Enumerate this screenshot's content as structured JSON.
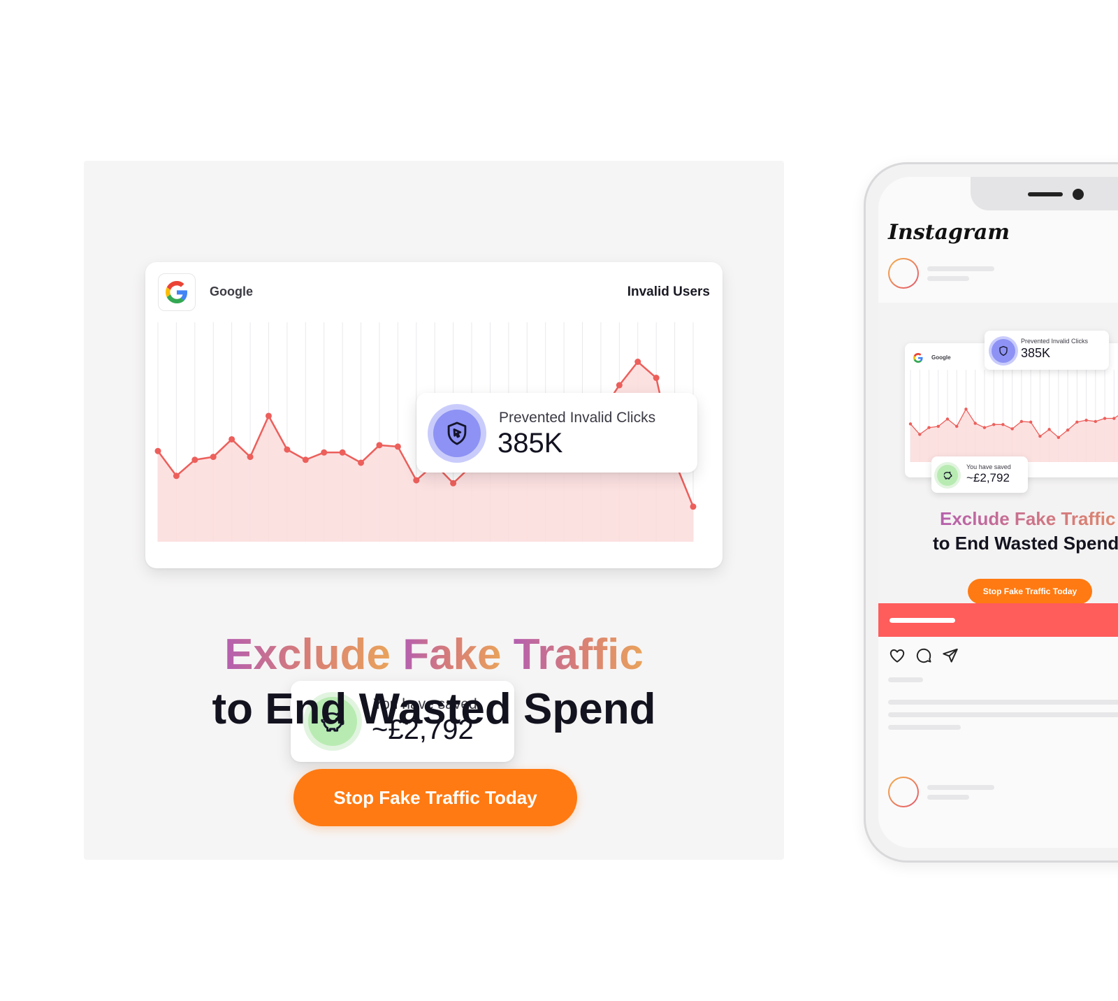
{
  "ad": {
    "google_label": "Google",
    "invalid_users_label": "Invalid Users",
    "stat_title": "Prevented Invalid Clicks",
    "stat_value": "385K",
    "saved_title": "You have saved",
    "saved_value": "~£2,792",
    "headline_line1_a": "Exclude",
    "headline_line1_b": "Fake",
    "headline_line1_c": "Traffic",
    "headline_line2": "to End Wasted Spend",
    "cta_label": "Stop Fake Traffic Today",
    "icons": [
      "google-g-icon",
      "shield-cursor-icon",
      "piggy-bank-icon"
    ],
    "colors": {
      "cta": "#ff7a12",
      "line": "#ec5f5b",
      "area": "#fbdcdc",
      "shield_badge": "#8d92f4",
      "pig_badge": "#b8ebb2",
      "gradient": [
        "#b45fb0",
        "#d87e76",
        "#e9a35b"
      ]
    }
  },
  "phone": {
    "app_name": "Instagram",
    "post": {
      "google_label": "Google",
      "stat_title": "Prevented Invalid Clicks",
      "stat_value": "385K",
      "saved_title": "You have saved",
      "saved_value": "~£2,792",
      "headline_line1": "Exclude Fake Traffic",
      "headline_line2": "to End Wasted Spend",
      "cta_label": "Stop Fake Traffic Today"
    },
    "banner_color": "#ff5c5c",
    "action_icons": [
      "heart-icon",
      "comment-icon",
      "send-icon"
    ]
  },
  "chart_data": {
    "type": "area",
    "title": "",
    "xlabel": "",
    "ylabel": "",
    "grid": "vertical",
    "y": [
      62,
      45,
      56,
      58,
      70,
      58,
      86,
      63,
      56,
      61,
      61,
      54,
      66,
      65,
      42,
      53,
      40,
      52,
      65,
      68,
      66,
      71,
      71,
      81,
      88,
      107,
      123,
      112,
      55,
      24
    ],
    "ylim": [
      0,
      150
    ]
  }
}
